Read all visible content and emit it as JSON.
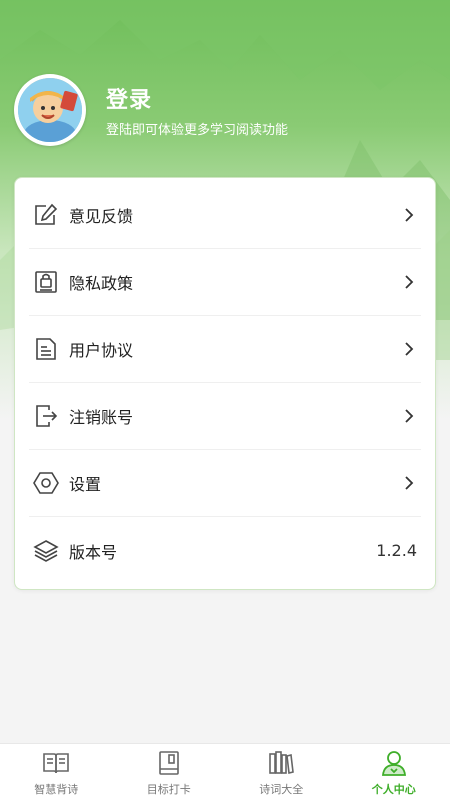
{
  "header": {
    "title": "登录",
    "subtitle": "登陆即可体验更多学习阅读功能",
    "avatar_icon": "cartoon-avatar-icon"
  },
  "menu": {
    "items": [
      {
        "label": "意见反馈",
        "icon": "feedback-edit-icon",
        "trailing": "chevron-right-icon"
      },
      {
        "label": "隐私政策",
        "icon": "privacy-lock-icon",
        "trailing": "chevron-right-icon"
      },
      {
        "label": "用户协议",
        "icon": "document-icon",
        "trailing": "chevron-right-icon"
      },
      {
        "label": "注销账号",
        "icon": "logout-icon",
        "trailing": "chevron-right-icon"
      },
      {
        "label": "设置",
        "icon": "hexagon-settings-icon",
        "trailing": "chevron-right-icon"
      },
      {
        "label": "版本号",
        "icon": "layers-icon",
        "value": "1.2.4"
      }
    ]
  },
  "tabbar": {
    "tabs": [
      {
        "label": "智慧背诗",
        "icon": "open-book-icon",
        "active": false
      },
      {
        "label": "目标打卡",
        "icon": "notebook-icon",
        "active": false
      },
      {
        "label": "诗词大全",
        "icon": "bookshelf-icon",
        "active": false
      },
      {
        "label": "个人中心",
        "icon": "person-icon",
        "active": true
      }
    ]
  },
  "colors": {
    "accent": "#3fae2a",
    "header_green": "#6fbe5a",
    "text": "#222222",
    "muted": "#777777"
  }
}
